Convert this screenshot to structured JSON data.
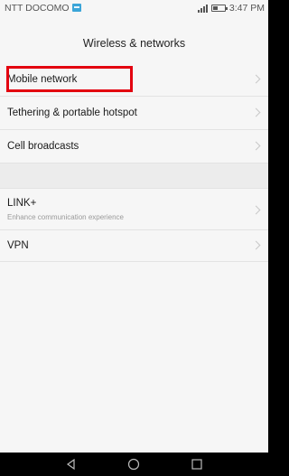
{
  "status_bar": {
    "carrier": "NTT DOCOMO",
    "time": "3:47 PM",
    "icons": [
      "notification-icon",
      "signal-icon",
      "battery-icon"
    ]
  },
  "header": {
    "title": "Wireless & networks"
  },
  "settings": {
    "items": [
      {
        "label": "Mobile network",
        "icon": "chevron-right-icon"
      },
      {
        "label": "Tethering & portable hotspot",
        "icon": "chevron-right-icon"
      },
      {
        "label": "Cell broadcasts",
        "icon": "chevron-right-icon"
      },
      {
        "label": "LINK+",
        "sublabel": "Enhance communication experience",
        "icon": "chevron-right-icon"
      },
      {
        "label": "VPN",
        "icon": "chevron-right-icon"
      }
    ]
  },
  "navigation_bar": {
    "buttons": [
      "back-icon",
      "home-icon",
      "recent-apps-icon"
    ]
  },
  "colors": {
    "highlight": "#e3000f",
    "background": "#f6f6f6",
    "nav_background": "#000000"
  }
}
